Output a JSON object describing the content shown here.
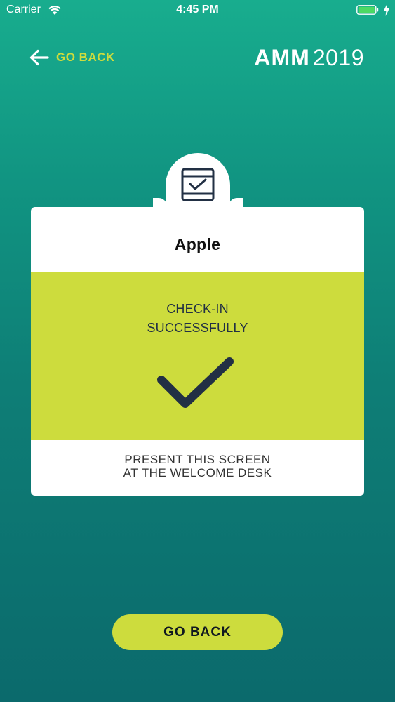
{
  "status_bar": {
    "carrier": "Carrier",
    "time": "4:45 PM"
  },
  "header": {
    "back_label": "GO BACK",
    "brand_bold": "AMM",
    "brand_year": "2019"
  },
  "card": {
    "title": "Apple",
    "status_line1": "CHECK-IN",
    "status_line2": "SUCCESSFULLY",
    "instruction_line1": "PRESENT THIS SCREEN",
    "instruction_line2": "AT THE WELCOME DESK"
  },
  "footer": {
    "button_label": "GO BACK"
  },
  "colors": {
    "accent": "#cddc3d",
    "dark": "#223044",
    "bg_top": "#18ad8e",
    "bg_bottom": "#0b6a6c"
  },
  "icons": {
    "back": "arrow-left-icon",
    "badge": "calendar-check-icon",
    "success": "checkmark-icon"
  }
}
